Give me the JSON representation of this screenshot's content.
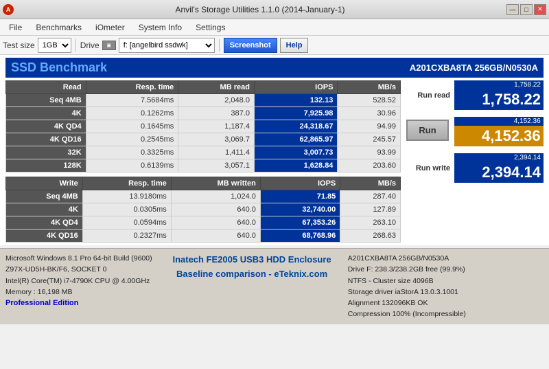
{
  "titlebar": {
    "title": "Anvil's Storage Utilities 1.1.0 (2014-January-1)",
    "icon": "A"
  },
  "winButtons": {
    "minimize": "—",
    "maximize": "□",
    "close": "✕"
  },
  "menu": {
    "items": [
      "File",
      "Benchmarks",
      "iOmeter",
      "System Info",
      "Settings"
    ]
  },
  "toolbar": {
    "test_size_label": "Test size",
    "test_size_value": "1GB",
    "drive_label": "Drive",
    "drive_value": "f: [angelbird ssdwk]",
    "screenshot_label": "Screenshot",
    "help_label": "Help"
  },
  "ssdHeader": {
    "title": "SSD Benchmark",
    "model": "A201CXBA8TA 256GB/N0530A"
  },
  "tableHeaders": {
    "col1": "Read",
    "col2": "Resp. time",
    "col3": "MB read",
    "col4": "IOPS",
    "col5": "MB/s"
  },
  "readRows": [
    {
      "label": "Seq 4MB",
      "resp": "7.5684ms",
      "mb": "2,048.0",
      "iops": "132.13",
      "mbs": "528.52"
    },
    {
      "label": "4K",
      "resp": "0.1262ms",
      "mb": "387.0",
      "iops": "7,925.98",
      "mbs": "30.96"
    },
    {
      "label": "4K QD4",
      "resp": "0.1645ms",
      "mb": "1,187.4",
      "iops": "24,318.67",
      "mbs": "94.99"
    },
    {
      "label": "4K QD16",
      "resp": "0.2545ms",
      "mb": "3,069.7",
      "iops": "62,865.97",
      "mbs": "245.57"
    },
    {
      "label": "32K",
      "resp": "0.3325ms",
      "mb": "1,411.4",
      "iops": "3,007.73",
      "mbs": "93.99"
    },
    {
      "label": "128K",
      "resp": "0.6139ms",
      "mb": "3,057.1",
      "iops": "1,628.84",
      "mbs": "203.60"
    }
  ],
  "writeHeaders": {
    "col1": "Write",
    "col2": "Resp. time",
    "col3": "MB written",
    "col4": "IOPS",
    "col5": "MB/s"
  },
  "writeRows": [
    {
      "label": "Seq 4MB",
      "resp": "13.9180ms",
      "mb": "1,024.0",
      "iops": "71.85",
      "mbs": "287.40"
    },
    {
      "label": "4K",
      "resp": "0.0305ms",
      "mb": "640.0",
      "iops": "32,740.00",
      "mbs": "127.89"
    },
    {
      "label": "4K QD4",
      "resp": "0.0594ms",
      "mb": "640.0",
      "iops": "67,353.26",
      "mbs": "263.10"
    },
    {
      "label": "4K QD16",
      "resp": "0.2327ms",
      "mb": "640.0",
      "iops": "68,768.96",
      "mbs": "268.63"
    }
  ],
  "scores": {
    "read_small": "1,758.22",
    "read_large": "1,758.22",
    "run_label": "Run",
    "total_small": "4,152.36",
    "total_large": "4,152.36",
    "write_small": "2,394.14",
    "write_large": "2,394.14",
    "run_read_label": "Run read",
    "run_write_label": "Run write"
  },
  "bottomInfo": {
    "sysinfo": [
      "Microsoft Windows 8.1 Pro 64-bit Build (9600)",
      "Z97X-UD5H-BK/F6, SOCKET 0",
      "Intel(R) Core(TM) i7-4790K CPU @ 4.00GHz",
      "Memory : 16,198 MB"
    ],
    "pro_edition": "Professional Edition",
    "baseline_line1": "Inatech FE2005 USB3 HDD Enclosure",
    "baseline_line2": "Baseline comparison - eTeknix.com",
    "drive_info": [
      "A201CXBA8TA 256GB/N0530A",
      "Drive F: 238.3/238.2GB free (99.9%)",
      "NTFS - Cluster size 4096B",
      "Storage driver  iaStorA 13.0.3.1001",
      "",
      "Alignment 132096KB OK",
      "Compression 100% (Incompressible)"
    ]
  }
}
